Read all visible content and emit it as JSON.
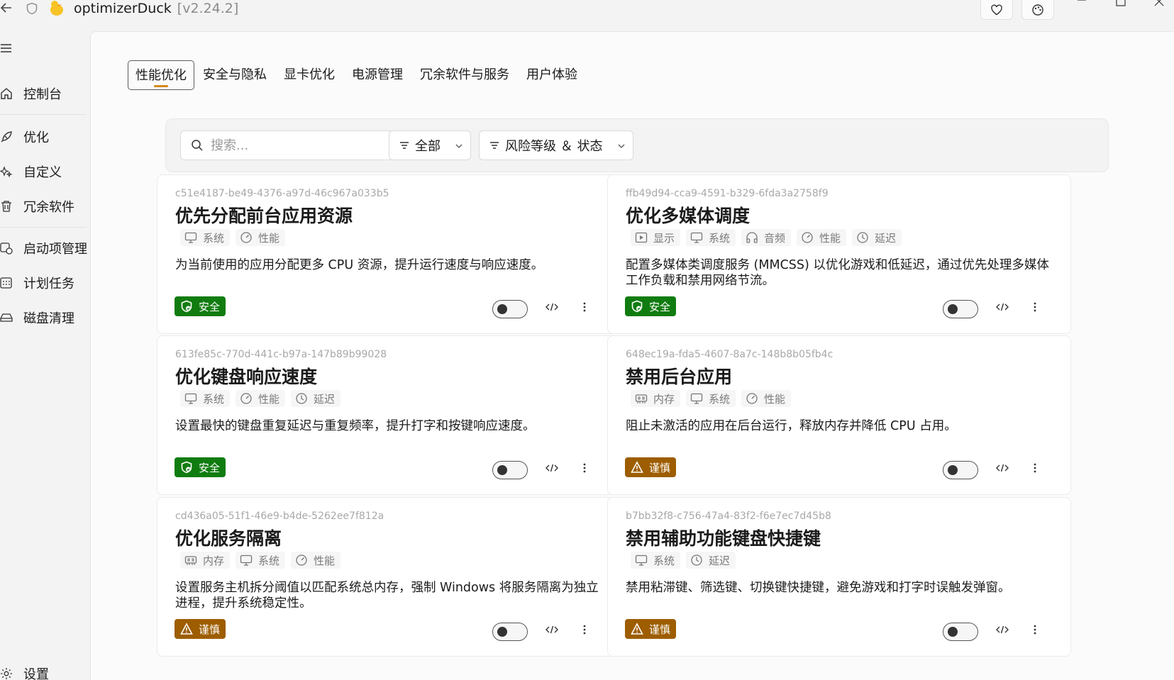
{
  "titlebar": {
    "app_name": "optimizerDuck",
    "version": "[v2.24.2]"
  },
  "sidebar": {
    "items": [
      {
        "label": "控制台",
        "icon": "home-icon"
      },
      {
        "label": "优化",
        "icon": "rocket-icon"
      },
      {
        "label": "自定义",
        "icon": "sparkle-icon"
      },
      {
        "label": "冗余软件",
        "icon": "trash-icon"
      },
      {
        "label": "启动项管理",
        "icon": "startup-icon"
      },
      {
        "label": "计划任务",
        "icon": "calendar-icon"
      },
      {
        "label": "磁盘清理",
        "icon": "disk-icon"
      }
    ],
    "settings_label": "设置"
  },
  "tabs": [
    {
      "label": "性能优化",
      "active": true
    },
    {
      "label": "安全与隐私",
      "active": false
    },
    {
      "label": "显卡优化",
      "active": false
    },
    {
      "label": "电源管理",
      "active": false
    },
    {
      "label": "冗余软件与服务",
      "active": false
    },
    {
      "label": "用户体验",
      "active": false
    }
  ],
  "filters": {
    "search_placeholder": "搜索...",
    "category_selected": "全部",
    "risk_label": "风险等级 ＆ 状态"
  },
  "cards": [
    {
      "id": "c51e4187-be49-4376-a97d-46c967a033b5",
      "title": "优先分配前台应用资源",
      "tags": [
        {
          "label": "系统",
          "icon": "monitor-icon"
        },
        {
          "label": "性能",
          "icon": "gauge-icon"
        }
      ],
      "desc": "为当前使用的应用分配更多 CPU 资源，提升运行速度与响应速度。",
      "risk": "安全",
      "risk_type": "safe",
      "enabled": false
    },
    {
      "id": "ffb49d94-cca9-4591-b329-6fda3a2758f9",
      "title": "优化多媒体调度",
      "tags": [
        {
          "label": "显示",
          "icon": "play-icon"
        },
        {
          "label": "系统",
          "icon": "monitor-icon"
        },
        {
          "label": "音频",
          "icon": "headphones-icon"
        },
        {
          "label": "性能",
          "icon": "gauge-icon"
        },
        {
          "label": "延迟",
          "icon": "clock-icon"
        }
      ],
      "desc": "配置多媒体类调度服务 (MMCSS) 以优化游戏和低延迟，通过优先处理多媒体工作负载和禁用网络节流。",
      "risk": "安全",
      "risk_type": "safe",
      "enabled": false
    },
    {
      "id": "613fe85c-770d-441c-b97a-147b89b99028",
      "title": "优化键盘响应速度",
      "tags": [
        {
          "label": "系统",
          "icon": "monitor-icon"
        },
        {
          "label": "性能",
          "icon": "gauge-icon"
        },
        {
          "label": "延迟",
          "icon": "clock-icon"
        }
      ],
      "desc": "设置最快的键盘重复延迟与重复频率，提升打字和按键响应速度。",
      "risk": "安全",
      "risk_type": "safe",
      "enabled": false
    },
    {
      "id": "648ec19a-fda5-4607-8a7c-148b8b05fb4c",
      "title": "禁用后台应用",
      "tags": [
        {
          "label": "内存",
          "icon": "memory-icon"
        },
        {
          "label": "系统",
          "icon": "monitor-icon"
        },
        {
          "label": "性能",
          "icon": "gauge-icon"
        }
      ],
      "desc": "阻止未激活的应用在后台运行，释放内存并降低 CPU 占用。",
      "risk": "谨慎",
      "risk_type": "caution",
      "enabled": false
    },
    {
      "id": "cd436a05-51f1-46e9-b4de-5262ee7f812a",
      "title": "优化服务隔离",
      "tags": [
        {
          "label": "内存",
          "icon": "memory-icon"
        },
        {
          "label": "系统",
          "icon": "monitor-icon"
        },
        {
          "label": "性能",
          "icon": "gauge-icon"
        }
      ],
      "desc": "设置服务主机拆分阈值以匹配系统总内存，强制 Windows 将服务隔离为独立进程，提升系统稳定性。",
      "risk": "谨慎",
      "risk_type": "caution",
      "enabled": false
    },
    {
      "id": "b7bb32f8-c756-47a4-83f2-f6e7ec7d45b8",
      "title": "禁用辅助功能键盘快捷键",
      "tags": [
        {
          "label": "系统",
          "icon": "monitor-icon"
        },
        {
          "label": "延迟",
          "icon": "clock-icon"
        }
      ],
      "desc": "禁用粘滞键、筛选键、切换键快捷键，避免游戏和打字时误触发弹窗。",
      "risk": "谨慎",
      "risk_type": "caution",
      "enabled": false
    }
  ],
  "colors": {
    "safe": "#107c10",
    "caution": "#9d5d00",
    "accent": "#d48a1e"
  }
}
